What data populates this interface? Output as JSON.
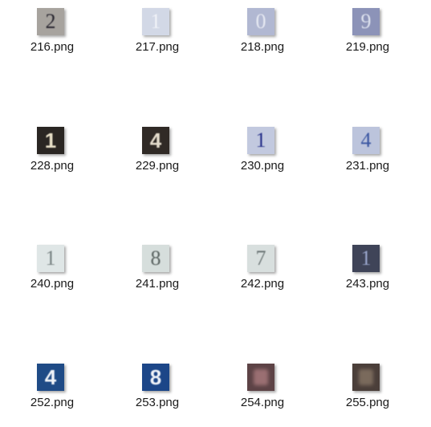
{
  "files": [
    {
      "name": "216.png",
      "thumb": {
        "digit": "2",
        "bg": "#a7a39e",
        "fg": "#2c2a33",
        "style": "serif"
      }
    },
    {
      "name": "217.png",
      "thumb": {
        "digit": "1",
        "bg": "#d2d8e6",
        "fg": "#f1f3f8",
        "style": "serif"
      }
    },
    {
      "name": "218.png",
      "thumb": {
        "digit": "0",
        "bg": "#b1b8d2",
        "fg": "#e6e9f2",
        "style": "serif"
      }
    },
    {
      "name": "219.png",
      "thumb": {
        "digit": "9",
        "bg": "#8c93b8",
        "fg": "#dde2ee",
        "style": "serif"
      }
    },
    {
      "name": "228.png",
      "thumb": {
        "digit": "1",
        "bg": "#2a2623",
        "fg": "#e8e0c8",
        "style": "sans"
      }
    },
    {
      "name": "229.png",
      "thumb": {
        "digit": "4",
        "bg": "#302a26",
        "fg": "#e4dccc",
        "style": "sans"
      }
    },
    {
      "name": "230.png",
      "thumb": {
        "digit": "1",
        "bg": "#c2c9df",
        "fg": "#27318a",
        "style": "serif"
      }
    },
    {
      "name": "231.png",
      "thumb": {
        "digit": "4",
        "bg": "#bcc4dc",
        "fg": "#3b57a2",
        "style": "serif"
      }
    },
    {
      "name": "240.png",
      "thumb": {
        "digit": "1",
        "bg": "#dfe6e6",
        "fg": "#7a8484",
        "style": "serif"
      }
    },
    {
      "name": "241.png",
      "thumb": {
        "digit": "8",
        "bg": "#d6dedc",
        "fg": "#5b6462",
        "style": "serif"
      }
    },
    {
      "name": "242.png",
      "thumb": {
        "digit": "7",
        "bg": "#d8dfde",
        "fg": "#6d7777",
        "style": "serif"
      }
    },
    {
      "name": "243.png",
      "thumb": {
        "digit": "1",
        "bg": "#3f4458",
        "fg": "#9aa6cc",
        "style": "serif"
      }
    },
    {
      "name": "252.png",
      "thumb": {
        "digit": "4",
        "bg": "#1f4b86",
        "fg": "#f2f4f8",
        "style": "sans"
      }
    },
    {
      "name": "253.png",
      "thumb": {
        "digit": "8",
        "bg": "#1c4688",
        "fg": "#f0f3f8",
        "style": "sans"
      }
    },
    {
      "name": "254.png",
      "thumb": {
        "digit": "",
        "bg": "#5d4346",
        "fg": "#9a6f72",
        "style": "smudge"
      }
    },
    {
      "name": "255.png",
      "thumb": {
        "digit": "",
        "bg": "#4b3f3a",
        "fg": "#7a6a5c",
        "style": "smudge"
      }
    }
  ]
}
